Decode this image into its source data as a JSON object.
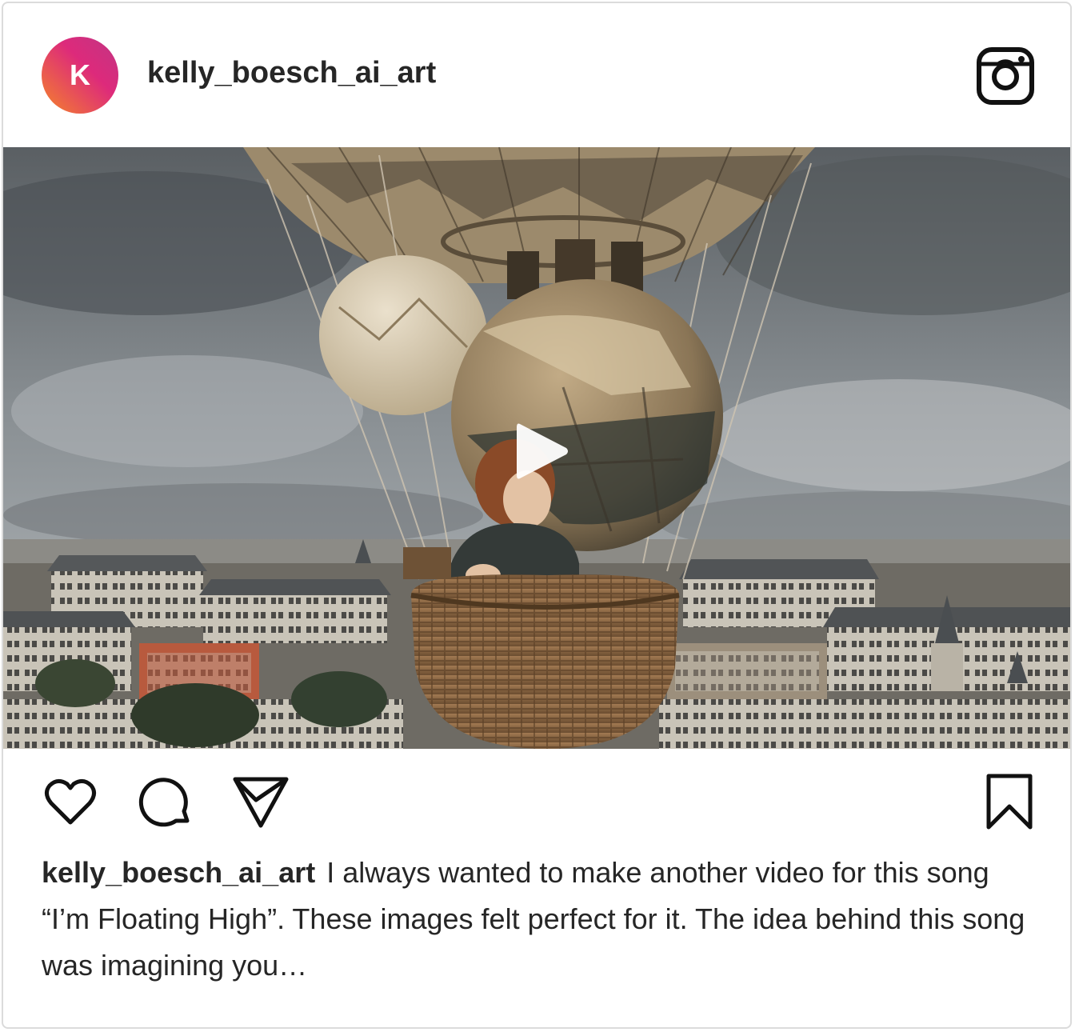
{
  "post": {
    "avatar_letter": "K",
    "username": "kelly_boesch_ai_art",
    "caption_username": "kelly_boesch_ai_art",
    "caption_text": "I always wanted to make another video for this song “I’m Floating High”. These images felt perfect for it. The idea behind this song was imagining you…"
  },
  "icons": {
    "header_logo": "instagram-logo-icon",
    "play": "play-icon",
    "like": "heart-icon",
    "comment": "comment-icon",
    "share": "send-icon",
    "save": "bookmark-icon"
  },
  "colors": {
    "text": "#262626",
    "border": "#dbdbdb",
    "avatar_gradient_start": "#f58529",
    "avatar_gradient_end": "#c13584"
  }
}
